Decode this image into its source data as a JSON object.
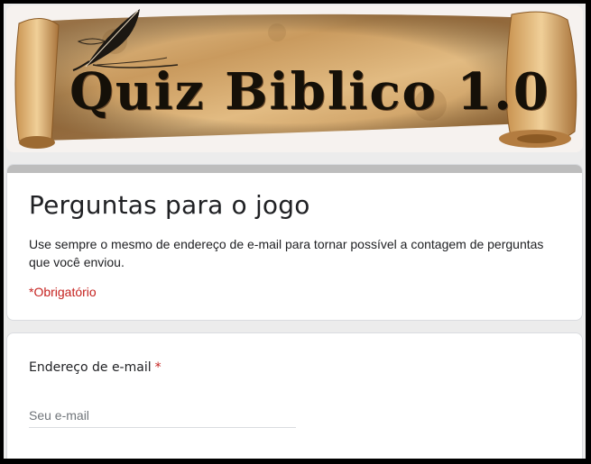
{
  "header": {
    "banner_title": "Quiz Biblico 1.0"
  },
  "form": {
    "title": "Perguntas para o jogo",
    "description": "Use sempre o mesmo de endereço de e-mail para tornar possível a contagem de perguntas que você enviou.",
    "required_note": "*Obrigatório"
  },
  "question": {
    "label": "Endereço de e-mail",
    "required_mark": "*",
    "placeholder": "Seu e-mail"
  },
  "colors": {
    "required": "#c5221f",
    "header_bar": "#bdbdbd",
    "parchment": "#d9b07a"
  },
  "icons": [
    "quill-pen-icon",
    "parchment-scroll"
  ]
}
